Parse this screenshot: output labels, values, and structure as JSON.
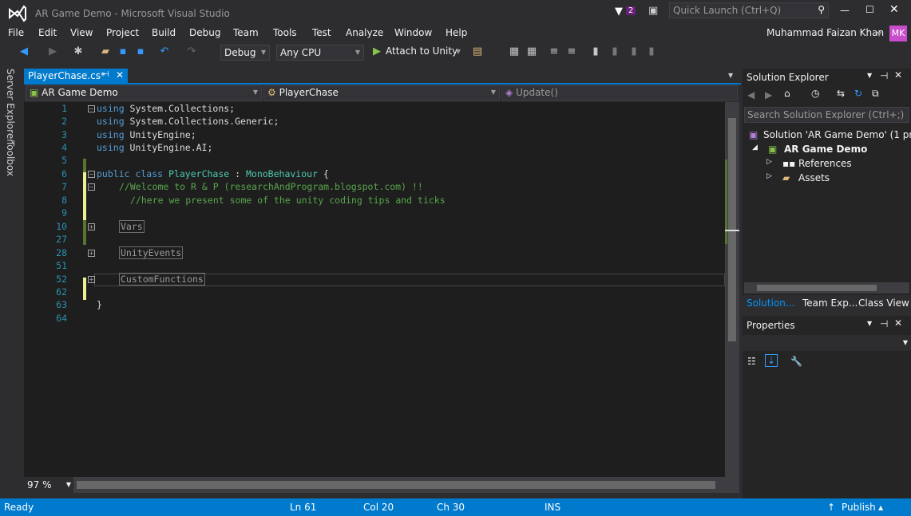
{
  "window": {
    "title": "AR Game Demo - Microsoft Visual Studio",
    "notification_count": "2",
    "quick_launch_placeholder": "Quick Launch (Ctrl+Q)",
    "user_name": "Muhammad Faizan Khan",
    "user_initials": "MK"
  },
  "menu": [
    "File",
    "Edit",
    "View",
    "Project",
    "Build",
    "Debug",
    "Team",
    "Tools",
    "Test",
    "Analyze",
    "Window",
    "Help"
  ],
  "toolbar": {
    "configuration": "Debug",
    "platform": "Any CPU",
    "attach_label": "Attach to Unity"
  },
  "left_strip": {
    "server_explorer": "Server Explorer",
    "toolbox": "Toolbox"
  },
  "document_tab": {
    "label": "PlayerChase.cs*"
  },
  "navigation_bar": {
    "project": "AR Game Demo",
    "class": "PlayerChase",
    "member": "Update()"
  },
  "code": {
    "lines": [
      {
        "num": "1",
        "text": "using System.Collections;"
      },
      {
        "num": "2",
        "text": "using System.Collections.Generic;"
      },
      {
        "num": "3",
        "text": "using UnityEngine;"
      },
      {
        "num": "4",
        "text": "using UnityEngine.AI;"
      },
      {
        "num": "5",
        "text": ""
      },
      {
        "num": "6",
        "text": "public class PlayerChase : MonoBehaviour {"
      },
      {
        "num": "7",
        "text": "//Welcome to R & P (researchAndProgram.blogspot.com) !!"
      },
      {
        "num": "8",
        "text": "//here we present some of the unity coding tips and ticks"
      },
      {
        "num": "9",
        "text": ""
      },
      {
        "num": "10",
        "text": "Vars"
      },
      {
        "num": "27",
        "text": ""
      },
      {
        "num": "28",
        "text": "UnityEvents"
      },
      {
        "num": "51",
        "text": ""
      },
      {
        "num": "52",
        "text": "CustomFunctions"
      },
      {
        "num": "62",
        "text": ""
      },
      {
        "num": "63",
        "text": "}"
      },
      {
        "num": "64",
        "text": ""
      }
    ]
  },
  "editor": {
    "zoom": "97 %"
  },
  "solution_explorer": {
    "title": "Solution Explorer",
    "search_placeholder": "Search Solution Explorer (Ctrl+;)",
    "solution": "Solution 'AR Game Demo' (1 pro",
    "project": "AR Game Demo",
    "references": "References",
    "assets": "Assets",
    "tabs": [
      "Solution...",
      "Team Exp...",
      "Class View"
    ]
  },
  "properties": {
    "title": "Properties"
  },
  "status": {
    "ready": "Ready",
    "ln": "Ln 61",
    "col": "Col 20",
    "ch": "Ch 30",
    "ins": "INS",
    "publish": "Publish"
  }
}
